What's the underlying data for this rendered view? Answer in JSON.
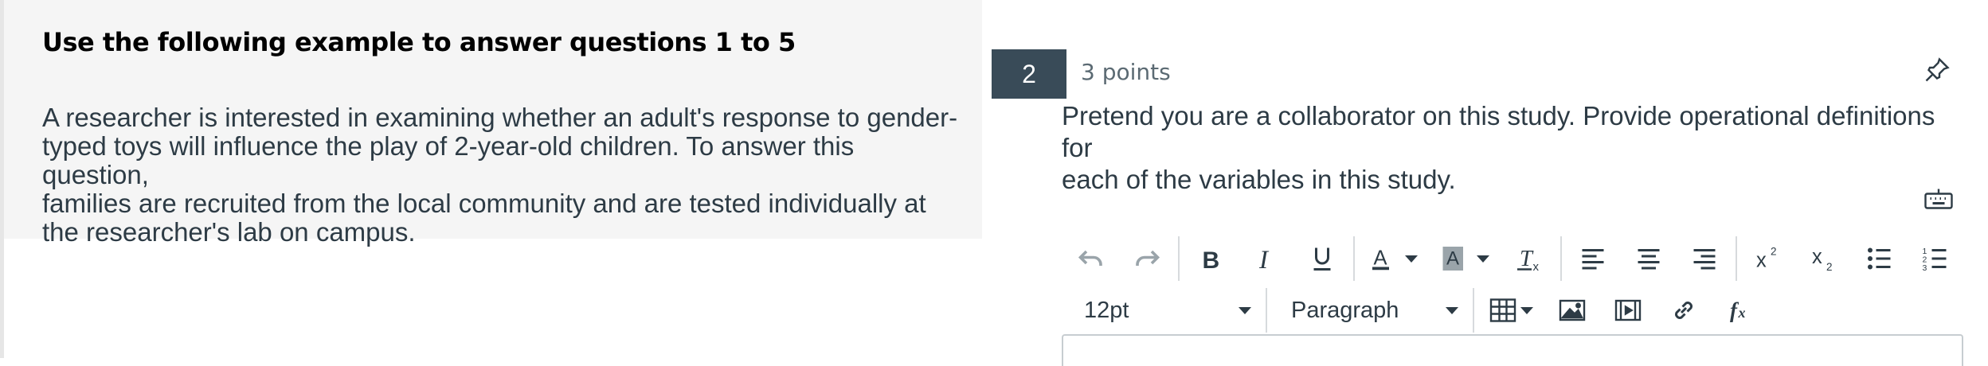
{
  "passage": {
    "heading": "Use the following example to answer questions 1 to 5",
    "lines": [
      "A researcher is interested in examining whether an adult's response to gender-",
      "typed toys will influence the play of 2-year-old children. To answer this question,",
      "families are recruited from the local community and are tested individually at",
      "the researcher's lab on campus."
    ]
  },
  "question": {
    "number": "2",
    "points": "3 points",
    "prompt_lines": [
      "Pretend you are a collaborator on this study. Provide operational definitions for",
      "each of the variables in this study."
    ]
  },
  "editor": {
    "font_size": "12pt",
    "block_format": "Paragraph",
    "toolbar_icons": [
      "undo-icon",
      "redo-icon",
      "bold-icon",
      "italic-icon",
      "underline-icon",
      "text-color-icon",
      "background-color-icon",
      "clear-formatting-icon",
      "align-left-icon",
      "align-center-icon",
      "align-right-icon",
      "superscript-icon",
      "subscript-icon",
      "bullet-list-icon",
      "numbered-list-icon"
    ],
    "toolbar2_icons": [
      "table-icon",
      "image-icon",
      "media-icon",
      "link-icon",
      "math-equation-icon"
    ]
  },
  "colors": {
    "accent": "#394b58",
    "text": "#2d3b45",
    "panel": "#f5f5f5"
  }
}
